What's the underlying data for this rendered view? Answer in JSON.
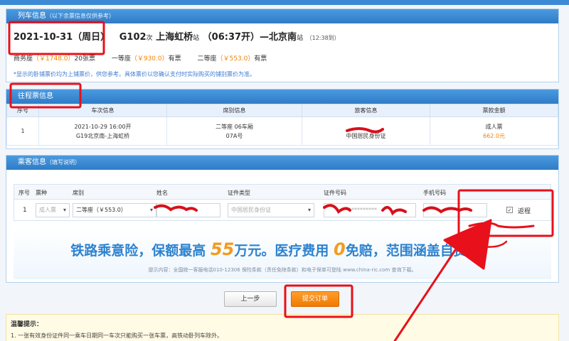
{
  "train_info": {
    "title": "列车信息",
    "title_note": "（以下余票信息仅供参考）",
    "date": "2021-10-31（周日）",
    "train_no": "G102",
    "train_suffix": "次",
    "from": "上海虹桥",
    "station_suffix": "站",
    "depart": "（06:37开）",
    "arrow": "—",
    "to": "北京南",
    "arrive": "（12:38到）",
    "seats": [
      {
        "name": "商务座",
        "price": "（￥1748.0）",
        "status": "20张票"
      },
      {
        "name": "一等座",
        "price": "（￥930.0）",
        "status": "有票"
      },
      {
        "name": "二等座",
        "price": "（￥553.0）",
        "status": "有票"
      }
    ],
    "note": "*显示的卧铺票价均为上铺票价，供您参考。具体票价以您确认支付时实际购买的铺别票价为准。"
  },
  "outbound": {
    "title": "往程票信息",
    "headers": [
      "序号",
      "车次信息",
      "席别信息",
      "旅客信息",
      "票款金额"
    ],
    "row": {
      "index": "1",
      "train_line1": "2021-10-29 16:00开",
      "train_line2": "G19北京南-上海虹桥",
      "seat_line1": "二等座 06车厢",
      "seat_line2": "07A号",
      "passenger_id": "中国居民身份证",
      "ticket_type": "成人票",
      "amount": "662.0元"
    }
  },
  "passenger": {
    "title": "乘客信息",
    "title_note": "（填写说明）",
    "headers": {
      "index": "序号",
      "ticket": "票种",
      "seat": "席别",
      "name": "姓名",
      "id_type": "证件类型",
      "id_no": "证件号码",
      "phone": "手机号码"
    },
    "row": {
      "index": "1",
      "ticket_type": "成人票",
      "seat_type": "二等座（￥553.0）",
      "id_type": "中国居民身份证",
      "id_no_masked": "**********",
      "return_label": "返程"
    }
  },
  "banner": {
    "text_a": "铁路乘意险，保额最高",
    "num_a": "55",
    "text_b": "万元。医疗费用",
    "num_b": "0",
    "text_c": "免赔，范围涵盖自费药。",
    "tip": "提示内容：全国统一客服电话010-12306 保险条款（责任免除条款）和电子保单可登陆 www.china-ric.com 查询下载。"
  },
  "buttons": {
    "prev": "上一步",
    "submit": "提交订单"
  },
  "tips": {
    "title": "温馨提示：",
    "line1": "1. 一张有效身份证件同一乘车日期同一车次只能购买一张车票，高铁动卧列车除外。"
  },
  "colors": {
    "header_blue": "#2f7cc6",
    "price_orange": "#f08300",
    "submit_orange": "#f07a00",
    "annotation_red": "#e8101a"
  }
}
